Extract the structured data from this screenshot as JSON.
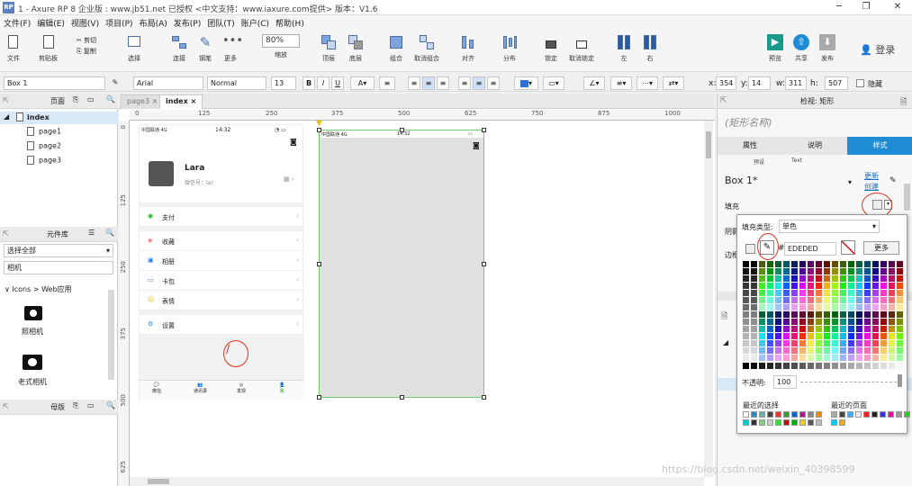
{
  "title": {
    "text": "1 - Axure RP 8 企业版 : www.jb51.net 已授权      <中文支持：www.iaxure.com提供> 版本：V1.6",
    "app_icon": "RP"
  },
  "menu": [
    "文件(F)",
    "编辑(E)",
    "视图(V)",
    "项目(P)",
    "布局(A)",
    "发布(P)",
    "团队(T)",
    "账户(C)",
    "帮助(H)"
  ],
  "toolbar": {
    "file": "文件",
    "clipboard": "剪贴板",
    "cut": "剪切",
    "copy": "复制",
    "paste": "粘贴",
    "select": "选择",
    "connect": "连接",
    "pen": "钢笔",
    "more": "更多",
    "zoom_value": "80%",
    "zoom_label": "缩放",
    "top": "顶层",
    "bottom": "底层",
    "group": "组合",
    "ungroup": "取消组合",
    "align": "对齐",
    "distribute": "分布",
    "lock": "锁定",
    "unlock": "取消锁定",
    "left": "左",
    "right": "右",
    "preview": "预览",
    "share": "共享",
    "publish": "发布",
    "login": "登录"
  },
  "format": {
    "widget_name": "Box 1",
    "font": "Arial",
    "style": "Normal",
    "size": "13",
    "x_label": "x:",
    "x": "354",
    "y_label": "y:",
    "y": "14",
    "w_label": "w:",
    "w": "311",
    "h_label": "h:",
    "h": "507",
    "hide": "隐藏"
  },
  "left": {
    "pages_title": "页面",
    "pages": [
      "index",
      "page1",
      "page2",
      "page3"
    ],
    "library_title": "元件库",
    "library_select": "选择全部",
    "library_search": "相机",
    "library_group": "Icons > Web应用",
    "items": [
      "照相机",
      "老式相机"
    ],
    "masters_title": "母版"
  },
  "tabs": [
    "page3",
    "index"
  ],
  "hruler": [
    "0",
    "125",
    "250",
    "375",
    "500",
    "625",
    "750",
    "875",
    "1000"
  ],
  "vruler": [
    "0",
    "125",
    "250",
    "375",
    "500",
    "625"
  ],
  "phone": {
    "status_left": "中国联通 4G",
    "time": "14:32",
    "name": "Lara",
    "wechat_label": "微信号：lar",
    "rows": [
      "支付",
      "收藏",
      "相册",
      "卡包",
      "表情",
      "设置"
    ],
    "note": "/",
    "tabs": [
      "微信",
      "通讯录",
      "发现",
      "我"
    ]
  },
  "box_status": {
    "left": "中国联通 4G",
    "time": "14:32"
  },
  "right": {
    "title": "检视: 矩形",
    "name_placeholder": "(矩形名称)",
    "tabs": [
      "属性",
      "说明",
      "样式"
    ],
    "sub": [
      "预设",
      "Text"
    ],
    "style_name": "Box 1*",
    "update": "更新",
    "create": "创建",
    "fill_label": "填充",
    "shadow_label": "阴影",
    "border_label": "边框"
  },
  "popup": {
    "fill_type_label": "填充类型:",
    "fill_type": "单色",
    "hash": "#",
    "hex": "EDEDED",
    "more": "更多",
    "opacity_label": "不透明:",
    "opacity": "100",
    "recent": "最近的选择",
    "recent_page": "最近的页面"
  },
  "watermark": "https://blog.csdn.net/weixin_40398599"
}
